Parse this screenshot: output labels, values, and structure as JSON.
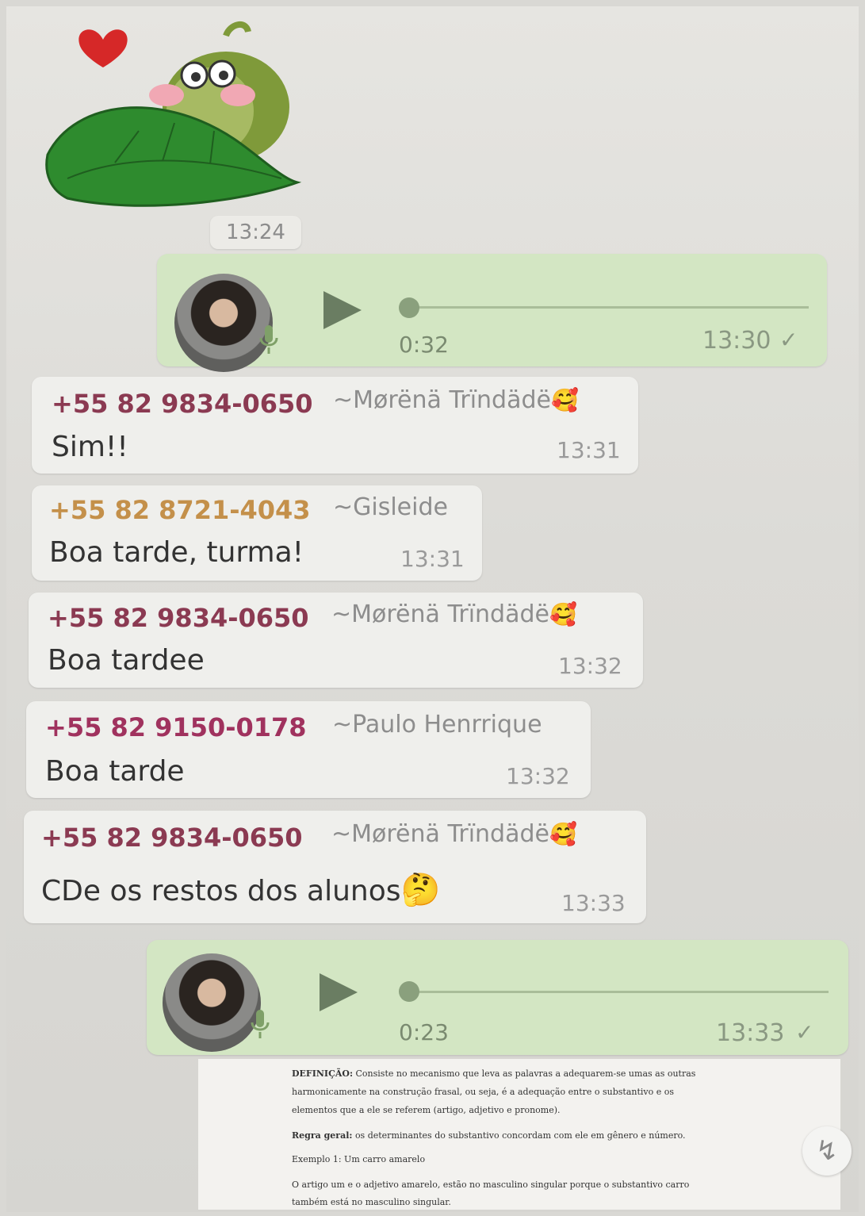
{
  "sticker": {
    "time": "13:24"
  },
  "voice_messages": [
    {
      "duration": "0:32",
      "time": "13:30",
      "status": "✓"
    },
    {
      "duration": "0:23",
      "time": "13:33",
      "status": "✓"
    }
  ],
  "messages": [
    {
      "phone": "+55 82 9834-0650",
      "nick": "~Mørënä  Trïndädë",
      "emoji": "🥰",
      "text": "Sim!!",
      "time": "13:31",
      "phone_color": "#8b3a52"
    },
    {
      "phone": "+55 82 8721-4043",
      "nick": "~Gisleide",
      "emoji": "",
      "text": "Boa tarde, turma!",
      "time": "13:31",
      "phone_color": "#c4904a"
    },
    {
      "phone": "+55 82 9834-0650",
      "nick": "~Mørënä  Trïndädë",
      "emoji": "🥰",
      "text": "Boa tardee",
      "time": "13:32",
      "phone_color": "#8b3a52"
    },
    {
      "phone": "+55 82 9150-0178",
      "nick": "~Paulo Henrrique",
      "emoji": "",
      "text": "Boa tarde",
      "time": "13:32",
      "phone_color": "#a0325e"
    },
    {
      "phone": "+55 82 9834-0650",
      "nick": "~Mørënä  Trïndädë",
      "emoji": "🥰",
      "text": "CDe os restos dos alunos",
      "text_emoji": "🤔",
      "time": "13:33",
      "phone_color": "#8b3a52"
    }
  ],
  "document": {
    "line1_bold": "DEFINIÇÃO:",
    "line1": "Consiste no mecanismo que leva as palavras a adequarem-se umas as outras",
    "line2": "harmonicamente na construção frasal, ou seja, é a adequação entre o substantivo e os",
    "line3": "elementos que a ele se referem (artigo, adjetivo e pronome).",
    "line4_bold": "Regra geral:",
    "line4": "os determinantes do substantivo concordam com ele em gênero e número.",
    "line5": "Exemplo 1: Um carro amarelo",
    "line6": "O artigo um e o adjetivo amarelo, estão no masculino singular porque o substantivo carro",
    "line7": "também está no masculino singular."
  },
  "scroll_icon": "double-chevron-down-icon",
  "colors": {
    "incoming_bubble": "#efefec",
    "outgoing_bubble": "#d3e6c3",
    "background": "#e0dfdb"
  }
}
